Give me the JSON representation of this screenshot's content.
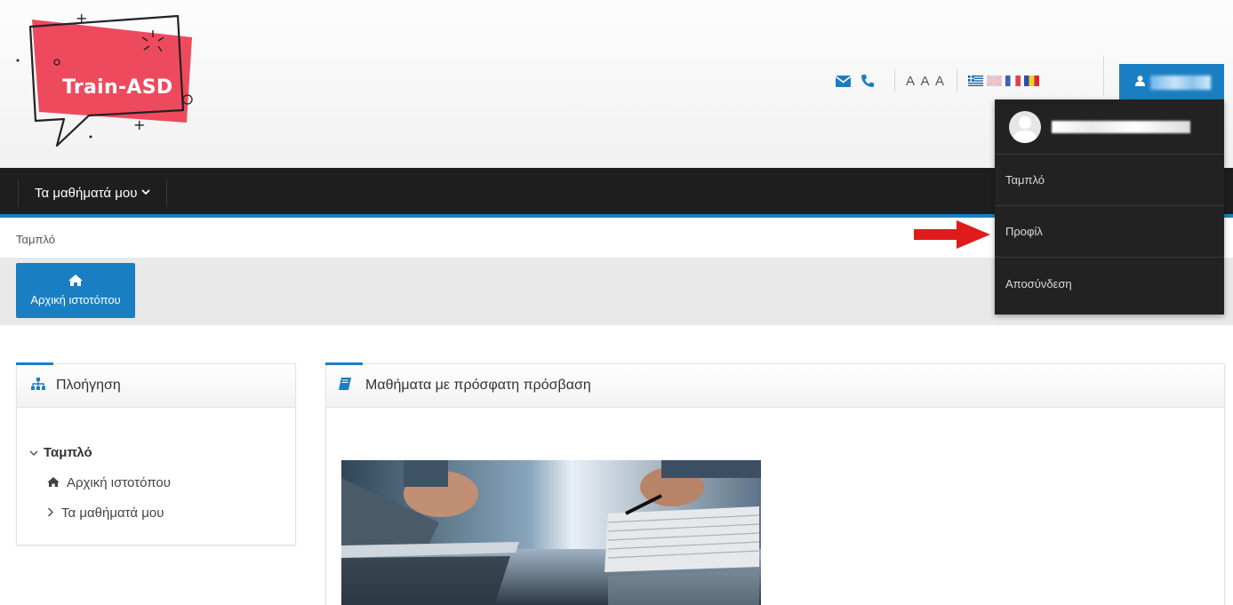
{
  "header": {
    "logo_text": "Train-ASD",
    "font_size_label": "A A A",
    "icons": [
      "envelope-icon",
      "phone-icon"
    ],
    "flags": [
      "greek-flag",
      "uk-flag",
      "french-flag",
      "romanian-flag"
    ]
  },
  "navbar": {
    "my_courses_label": "Τα μαθήματά μου"
  },
  "breadcrumb": {
    "dashboard": "Ταμπλό"
  },
  "toolbar": {
    "home_label": "Αρχική ιστοτόπου"
  },
  "dropdown": {
    "items": [
      {
        "label": "Ταμπλό"
      },
      {
        "label": "Προφίλ"
      },
      {
        "label": "Αποσύνδεση"
      }
    ]
  },
  "navigation_block": {
    "title": "Πλοήγηση",
    "root": "Ταμπλό",
    "children": [
      {
        "label": "Αρχική ιστοτόπου",
        "icon": "home-icon"
      },
      {
        "label": "Τα μαθήματά μου",
        "icon": "chevron-right-icon"
      }
    ]
  },
  "recent_block": {
    "title": "Μαθήματα με πρόσφατη πρόσβαση"
  },
  "colors": {
    "accent": "#1a7fc2",
    "navbar": "#1e1e1e",
    "dropdown": "#222222",
    "logo_red": "#ee4a5e",
    "pointer_arrow": "#e01b1b"
  }
}
